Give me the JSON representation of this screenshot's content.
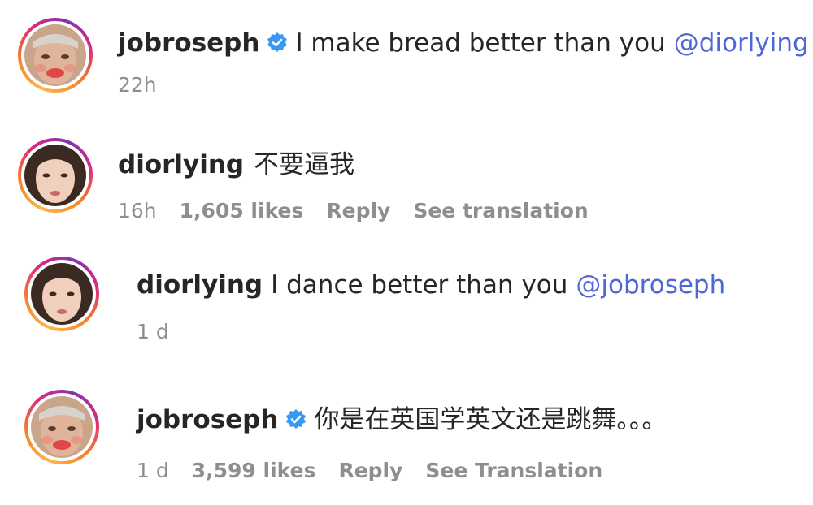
{
  "comments": [
    {
      "username": "jobroseph",
      "verified": true,
      "text": "I make bread better than you",
      "mention": "@diorlying",
      "time": "22h",
      "avatar": "male-avatar"
    },
    {
      "username": "diorlying",
      "verified": false,
      "text": "不要逼我",
      "time": "16h",
      "likes": "1,605 likes",
      "reply": "Reply",
      "translate": "See translation",
      "avatar": "female-avatar"
    },
    {
      "username": "diorlying",
      "verified": false,
      "text": "I dance better than you",
      "mention": "@jobroseph",
      "time": "1 d",
      "avatar": "female-avatar"
    },
    {
      "username": "jobroseph",
      "verified": true,
      "text": "你是在英国学英文还是跳舞。。。",
      "time": "1 d",
      "likes": "3,599 likes",
      "reply": "Reply",
      "translate": "See Translation",
      "avatar": "male-avatar"
    }
  ],
  "colors": {
    "mention": "#4e67d8",
    "verified_badge": "#3897f0",
    "meta": "#8e8e8e"
  }
}
